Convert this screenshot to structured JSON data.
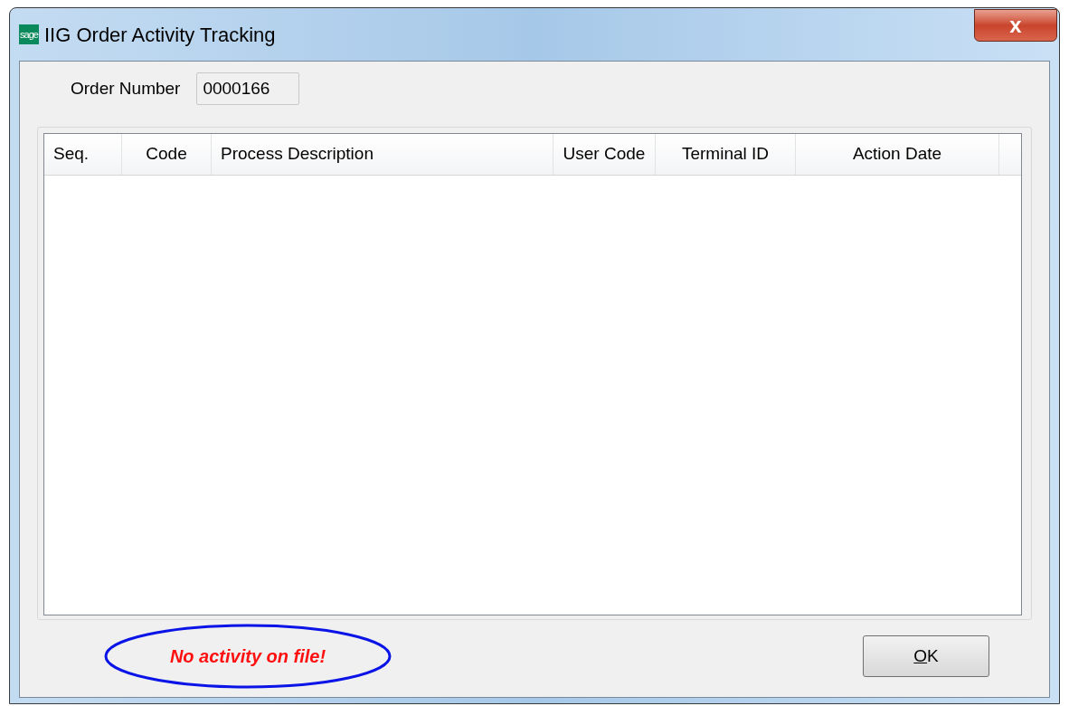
{
  "window": {
    "logo": "sage",
    "title": "IIG Order Activity Tracking",
    "close": "x"
  },
  "order_number": {
    "label": "Order Number",
    "value": "0000166"
  },
  "table": {
    "columns": [
      "Seq.",
      "Code",
      "Process Description",
      "User Code",
      "Terminal ID",
      "Action Date"
    ]
  },
  "message": "No activity on file!",
  "buttons": [
    {
      "label": "OK",
      "first_letter_underlined": true
    }
  ]
}
